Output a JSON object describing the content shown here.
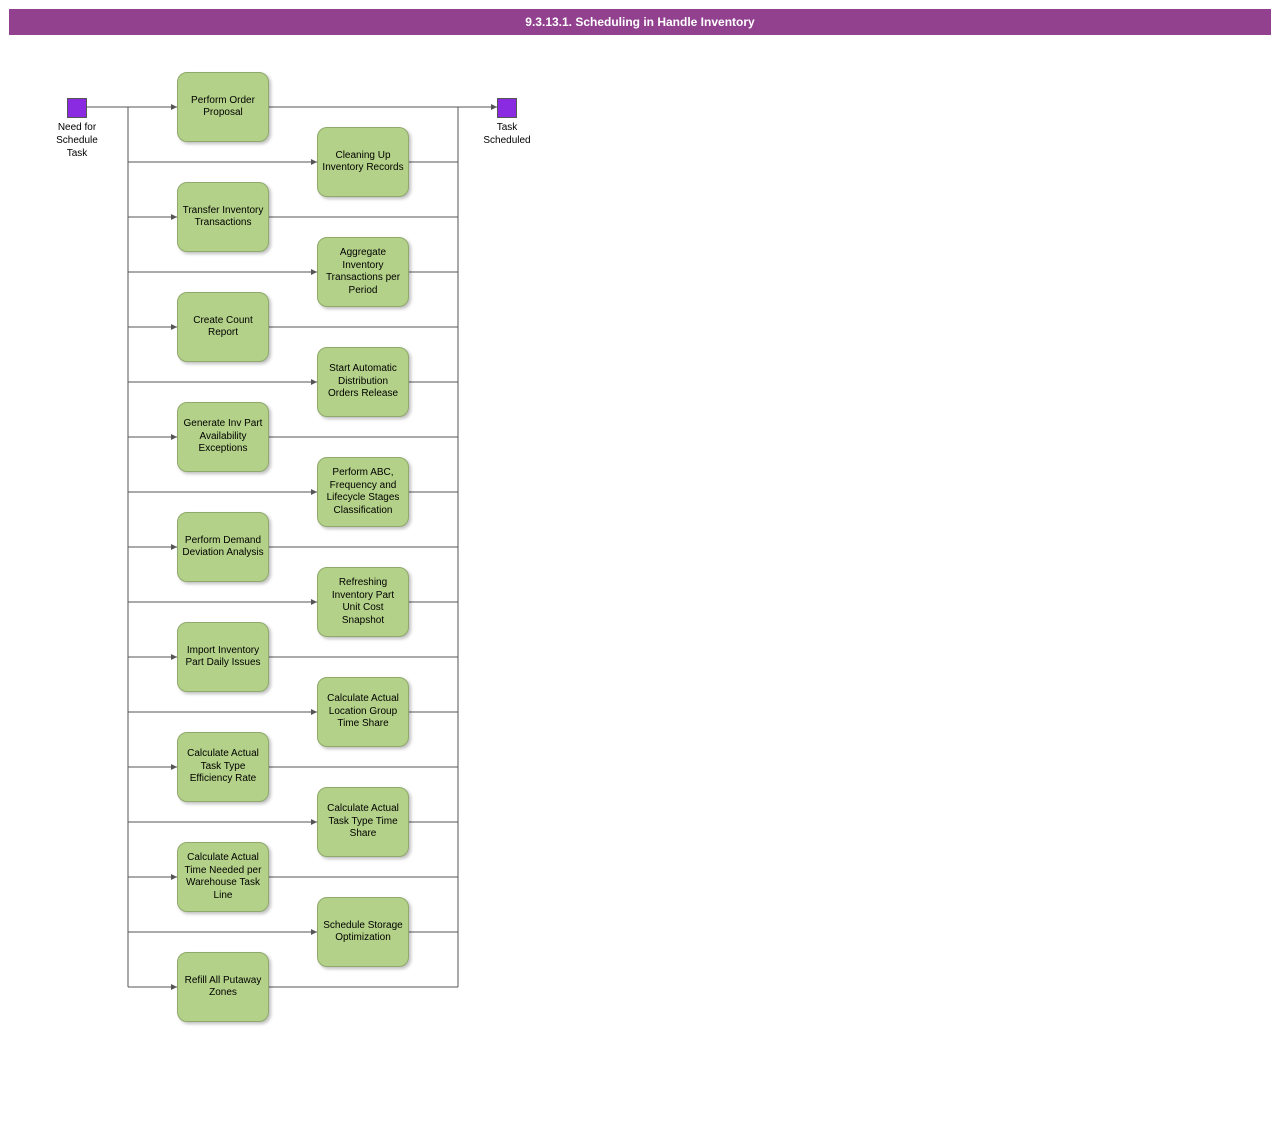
{
  "header": {
    "title": "9.3.13.1. Scheduling in Handle Inventory"
  },
  "events": {
    "start": {
      "label": "Need for\nSchedule\nTask"
    },
    "end": {
      "label": "Task\nScheduled"
    }
  },
  "tasks": {
    "t1": "Perform Order Proposal",
    "t2": "Cleaning Up Inventory Records",
    "t3": "Transfer Inventory Transactions",
    "t4": "Aggregate Inventory Transactions per Period",
    "t5": "Create Count Report",
    "t6": "Start Automatic Distribution Orders Release",
    "t7": "Generate Inv Part Availability Exceptions",
    "t8": "Perform ABC, Frequency and Lifecycle Stages Classification",
    "t9": "Perform Demand Deviation Analysis",
    "t10": "Refreshing Inventory Part Unit Cost Snapshot",
    "t11": "Import Inventory Part Daily Issues",
    "t12": "Calculate Actual Location Group Time Share",
    "t13": "Calculate Actual Task Type Efficiency Rate",
    "t14": "Calculate Actual Task Type Time Share",
    "t15": "Calculate Actual Time Needed per Warehouse Task Line",
    "t16": "Schedule Storage Optimization",
    "t17": "Refill All Putaway Zones"
  }
}
